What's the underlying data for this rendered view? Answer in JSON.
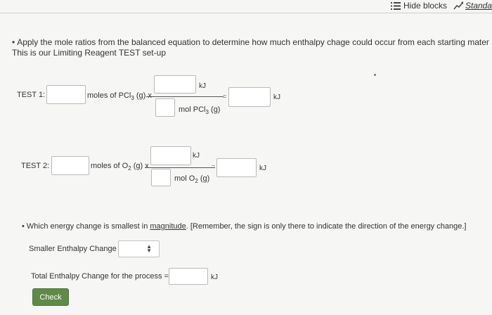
{
  "toolbar": {
    "hide_blocks": "Hide blocks",
    "standard": "Standa"
  },
  "intro": {
    "line1": "Apply the mole ratios from the balanced equation to determine how much enthalpy chage could occur from each starting mater",
    "line2": "This is our Limiting Reagent TEST set-up"
  },
  "test1": {
    "label": "TEST 1:",
    "moles_label_pre": "moles of PCl",
    "moles_sub": "3",
    "moles_label_post": " (g) x",
    "num_unit": "kJ",
    "den_unit_pre": "mol PCl",
    "den_sub": "3",
    "den_unit_post": " (g)",
    "eq": "=",
    "result_unit": "kJ"
  },
  "test2": {
    "label": "TEST 2:",
    "moles_label_pre": "moles of O",
    "moles_sub": "2",
    "moles_label_post": " (g) x",
    "num_unit": "kJ",
    "den_unit_pre": "mol O",
    "den_sub": "2",
    "den_unit_post": " (g)",
    "eq": "=",
    "result_unit": "kJ"
  },
  "question": {
    "pre": "Which energy change is smallest in ",
    "underlined": "magnitude",
    "post": ". [Remember, the sign is only there to indicate the direction of the energy change.]"
  },
  "smaller": {
    "label": "Smaller Enthalpy Change",
    "selected": ""
  },
  "total": {
    "label": "Total Enthalpy Change for the process =",
    "unit": "kJ"
  },
  "check_label": "Check"
}
